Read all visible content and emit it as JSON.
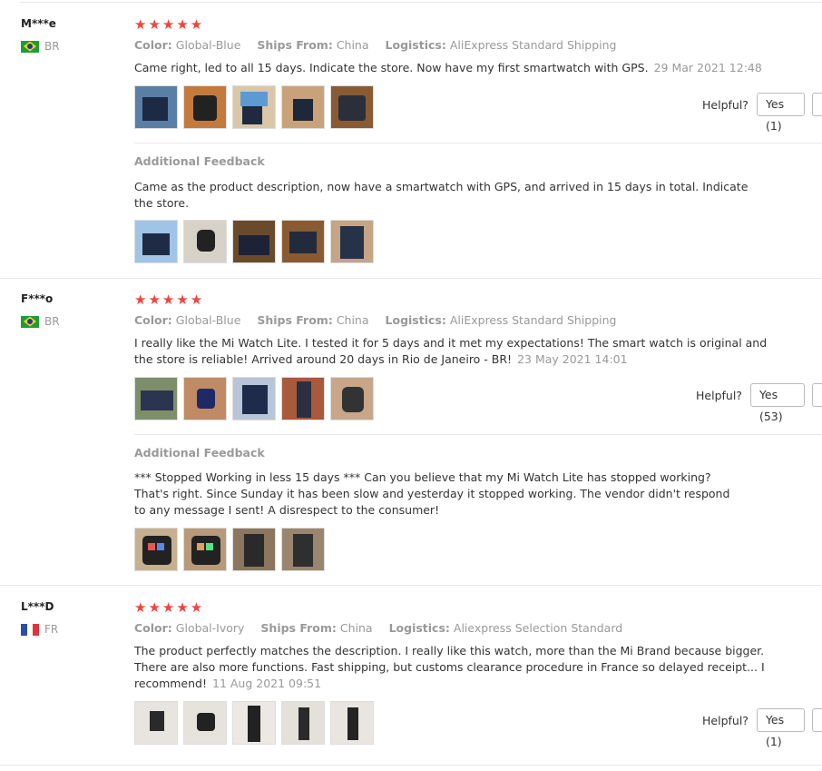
{
  "helpful_label": "Helpful?",
  "accent_color": "#f0453d",
  "reviews": [
    {
      "user": "M***e",
      "country": "BR",
      "flag": "brazil-flag-icon",
      "stars": "★★★★★",
      "color_label": "Color:",
      "color": "Global-Blue",
      "ships_label": "Ships From:",
      "ships": "China",
      "logistics_label": "Logistics:",
      "logistics": "AliExpress Standard Shipping",
      "text": "Came right, led to all 15 days. Indicate the store. Now have my first smartwatch with GPS.",
      "date": "29 Mar 2021 12:48",
      "helpful_yes": "Yes (1)",
      "additional_label": "Additional Feedback",
      "additional_text": "Came as the product description, now have a smartwatch with GPS, and arrived in 15 days in total. Indicate the store."
    },
    {
      "user": "F***o",
      "country": "BR",
      "flag": "brazil-flag-icon",
      "stars": "★★★★★",
      "color_label": "Color:",
      "color": "Global-Blue",
      "ships_label": "Ships From:",
      "ships": "China",
      "logistics_label": "Logistics:",
      "logistics": "AliExpress Standard Shipping",
      "text": "I really like the Mi Watch Lite. I tested it for 5 days and it met my expectations! The smart watch is original and the store is reliable! Arrived around 20 days in Rio de Janeiro - BR!",
      "date": "23 May 2021 14:01",
      "helpful_yes": "Yes (53)",
      "additional_label": "Additional Feedback",
      "additional_text": "*** Stopped Working in less 15 days *** Can you believe that my Mi Watch Lite has stopped working? That's right. Since Sunday it has been slow and yesterday it stopped working. The vendor didn't respond to any message I sent! A disrespect to the consumer!"
    },
    {
      "user": "L***D",
      "country": "FR",
      "flag": "france-flag-icon",
      "stars": "★★★★★",
      "color_label": "Color:",
      "color": "Global-Ivory",
      "ships_label": "Ships From:",
      "ships": "China",
      "logistics_label": "Logistics:",
      "logistics": "Aliexpress Selection Standard",
      "text": "The product perfectly matches the description. I really like this watch, more than the Mi Brand because bigger. There are also more functions. Fast shipping, but customs clearance procedure in France so delayed receipt... I recommend!",
      "date": "11 Aug 2021 09:51",
      "helpful_yes": "Yes (1)"
    }
  ]
}
